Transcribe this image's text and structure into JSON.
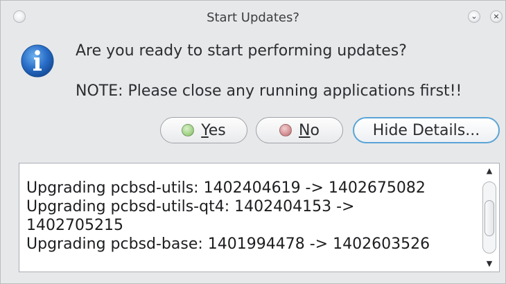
{
  "window": {
    "title": "Start Updates?"
  },
  "message": {
    "question": "Are you ready to start performing updates?",
    "note": "NOTE: Please close any running applications first!!"
  },
  "buttons": {
    "yes_label": "Yes",
    "yes_mnemonic": "Y",
    "yes_rest": "es",
    "no_label": "No",
    "no_mnemonic": "N",
    "no_rest": "o",
    "details_label": "Hide Details...",
    "yes_dot_color": "#7fbf5f",
    "no_dot_color": "#c0666a"
  },
  "details": {
    "lines": [
      "Upgrading pcbsd-utils: 1402404619 -> 1402675082",
      "Upgrading pcbsd-utils-qt4: 1402404153 ->",
      "1402705215",
      "Upgrading pcbsd-base: 1401994478 -> 1402603526"
    ]
  },
  "icons": {
    "window_menu": "window-menu-icon",
    "minimize": "minimize-icon",
    "close": "close-icon",
    "info": "info-icon",
    "scroll_up": "scroll-up-icon",
    "scroll_down": "scroll-down-icon"
  },
  "colors": {
    "info_blue": "#2a6fc9",
    "focus_border": "#5aa4d6"
  }
}
